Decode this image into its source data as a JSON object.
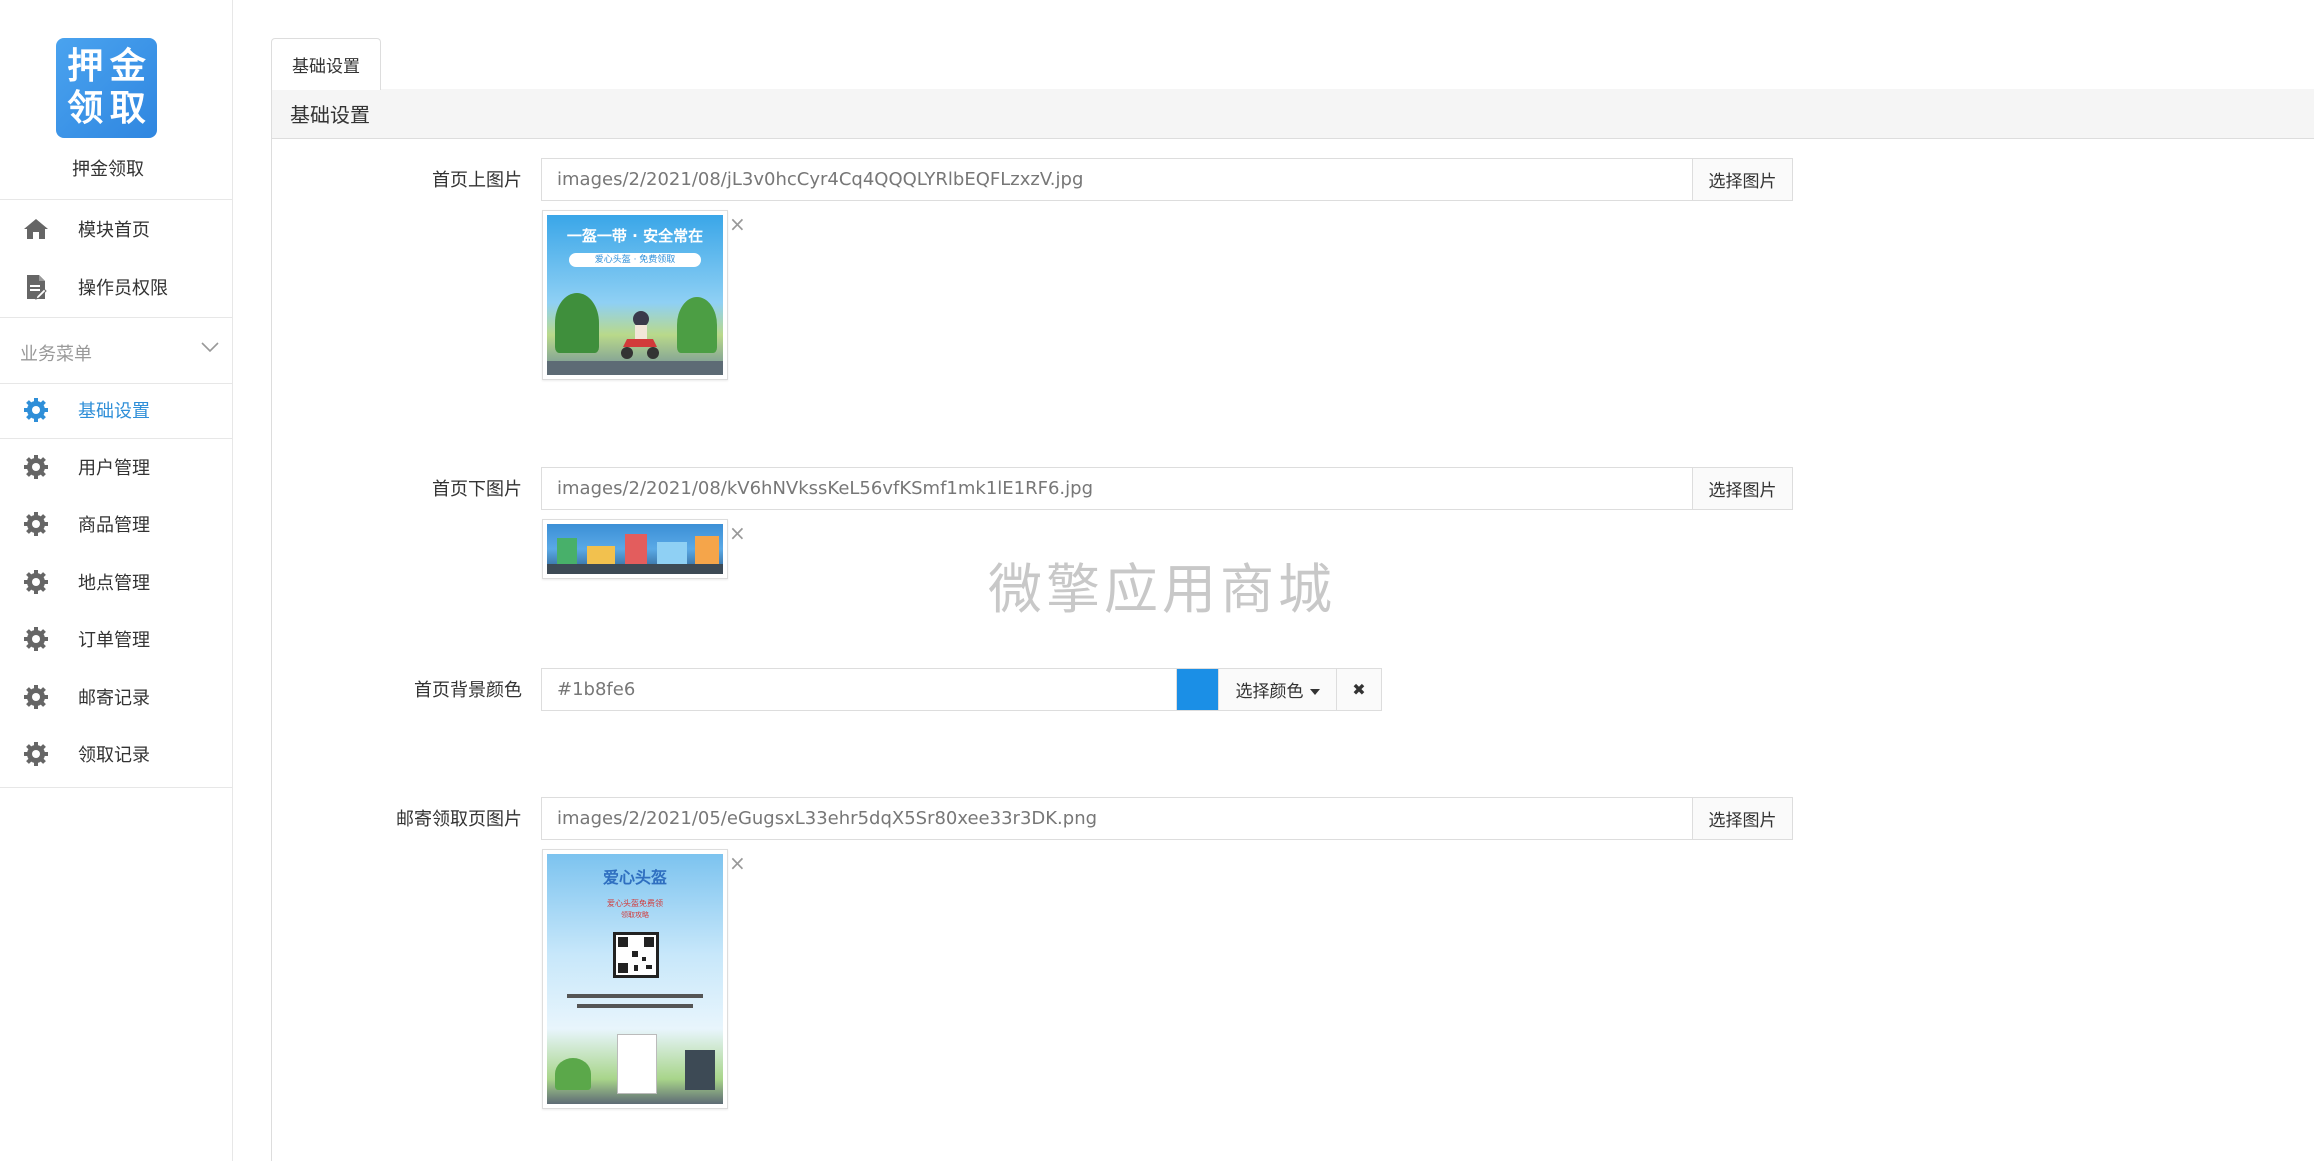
{
  "sidebar": {
    "logo_chars": [
      "押",
      "金",
      "领",
      "取"
    ],
    "app_name": "押金领取",
    "top_items": [
      {
        "label": "模块首页",
        "icon": "home-icon"
      },
      {
        "label": "操作员权限",
        "icon": "document-icon"
      }
    ],
    "group_title": "业务菜单",
    "items": [
      {
        "label": "基础设置",
        "icon": "gear-icon",
        "active": true
      },
      {
        "label": "用户管理",
        "icon": "gear-icon"
      },
      {
        "label": "商品管理",
        "icon": "gear-icon"
      },
      {
        "label": "地点管理",
        "icon": "gear-icon"
      },
      {
        "label": "订单管理",
        "icon": "gear-icon"
      },
      {
        "label": "邮寄记录",
        "icon": "gear-icon"
      },
      {
        "label": "领取记录",
        "icon": "gear-icon"
      }
    ]
  },
  "main": {
    "tab_label": "基础设置",
    "panel_title": "基础设置",
    "watermark": "微擎应用商城",
    "fields": {
      "top_image": {
        "label": "首页上图片",
        "value": "images/2/2021/08/jL3v0hcCyr4Cq4QQQLYRlbEQFLzxzV.jpg",
        "button": "选择图片",
        "thumb_title": "一盔一带 · 安全常在",
        "thumb_sub": "爱心头盔 · 免费领取"
      },
      "bottom_image": {
        "label": "首页下图片",
        "value": "images/2/2021/08/kV6hNVkssKeL56vfKSmf1mk1lE1RF6.jpg",
        "button": "选择图片"
      },
      "bg_color": {
        "label": "首页背景颜色",
        "value": "#1b8fe6",
        "swatch": "#1b8fe6",
        "button": "选择颜色",
        "clear": "✖"
      },
      "mail_image": {
        "label": "邮寄领取页图片",
        "value": "images/2/2021/05/eGugsxL33ehr5dqX5Sr80xee33r3DK.png",
        "button": "选择图片",
        "thumb_title": "爱心头盔",
        "thumb_sub": "爱心头盔免费领",
        "thumb_tag": "领取攻略"
      }
    },
    "close_glyph": "×"
  },
  "colors": {
    "accent": "#2f8fd8",
    "swatch": "#1b8fe6"
  }
}
